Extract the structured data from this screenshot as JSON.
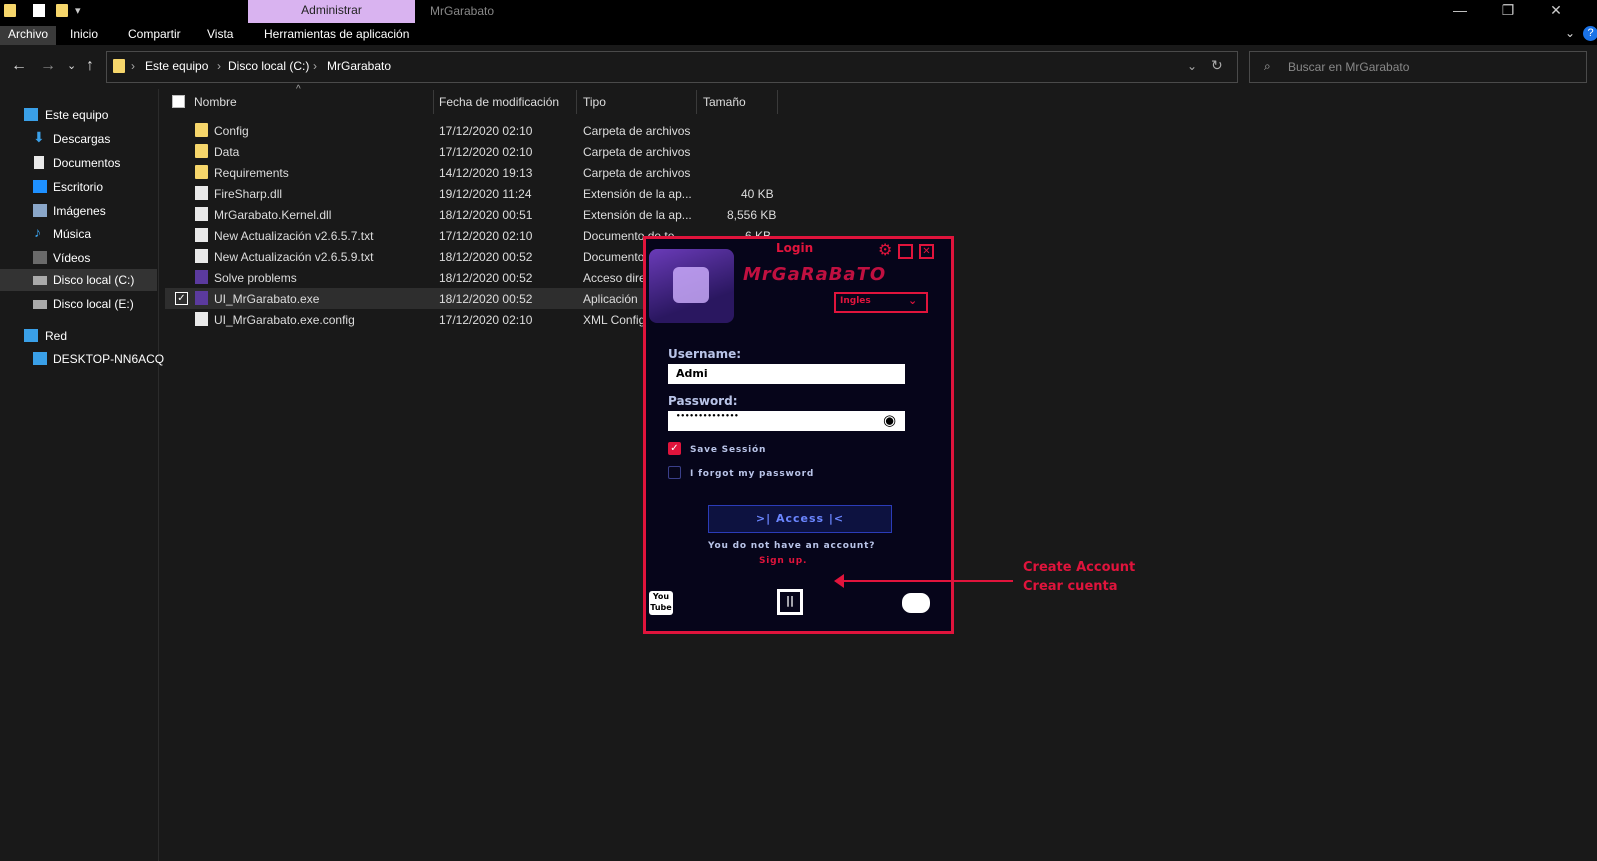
{
  "titlebar": {
    "tab_label": "Administrar",
    "window_title": "MrGarabato"
  },
  "ribbon": {
    "tabs": [
      "Archivo",
      "Inicio",
      "Compartir",
      "Vista",
      "Herramientas de aplicación"
    ]
  },
  "address": {
    "crumbs": [
      "Este equipo",
      "Disco local (C:)",
      "MrGarabato"
    ],
    "search_placeholder": "Buscar en MrGarabato"
  },
  "navpane": {
    "items": [
      "Este equipo",
      "Descargas",
      "Documentos",
      "Escritorio",
      "Imágenes",
      "Música",
      "Vídeos",
      "Disco local (C:)",
      "Disco local (E:)",
      "Red",
      "DESKTOP-NN6ACQ"
    ]
  },
  "columns": {
    "name": "Nombre",
    "date": "Fecha de modificación",
    "type": "Tipo",
    "size": "Tamaño"
  },
  "files": [
    {
      "name": "Config",
      "date": "17/12/2020 02:10",
      "type": "Carpeta de archivos",
      "size": "",
      "icon": "folder"
    },
    {
      "name": "Data",
      "date": "17/12/2020 02:10",
      "type": "Carpeta de archivos",
      "size": "",
      "icon": "folder"
    },
    {
      "name": "Requirements",
      "date": "14/12/2020 19:13",
      "type": "Carpeta de archivos",
      "size": "",
      "icon": "folder"
    },
    {
      "name": "FireSharp.dll",
      "date": "19/12/2020 11:24",
      "type": "Extensión de la ap...",
      "size": "40 KB",
      "icon": "file"
    },
    {
      "name": "MrGarabato.Kernel.dll",
      "date": "18/12/2020 00:51",
      "type": "Extensión de la ap...",
      "size": "8,556 KB",
      "icon": "file"
    },
    {
      "name": "New Actualización v2.6.5.7.txt",
      "date": "17/12/2020 02:10",
      "type": "Documento de te",
      "size": "6 KB",
      "icon": "file"
    },
    {
      "name": "New Actualización v2.6.5.9.txt",
      "date": "18/12/2020 00:52",
      "type": "Documento",
      "size": "",
      "icon": "file"
    },
    {
      "name": "Solve problems",
      "date": "18/12/2020 00:52",
      "type": "Acceso dire",
      "size": "",
      "icon": "shortcut"
    },
    {
      "name": "UI_MrGarabato.exe",
      "date": "18/12/2020 00:52",
      "type": "Aplicación",
      "size": "",
      "icon": "exe"
    },
    {
      "name": "UI_MrGarabato.exe.config",
      "date": "17/12/2020 02:10",
      "type": "XML Config",
      "size": "",
      "icon": "file"
    }
  ],
  "login": {
    "title": "Login",
    "brand": "MrGaRaBaTO",
    "language": "Ingles",
    "username_label": "Username:",
    "username_value": "Admi",
    "password_label": "Password:",
    "password_value": "••••••••••••••",
    "save_session": "Save Sessión",
    "forgot": "I forgot my password",
    "access": ">| Access |<",
    "no_account": "You do not have an account?",
    "sign_up": "Sign up."
  },
  "annotation": {
    "line1": "Create Account",
    "line2": "Crear cuenta"
  },
  "colors": {
    "accent_red": "#e0143c",
    "dialog_bg": "#06051a",
    "tab_purple": "#d9b3f0"
  }
}
